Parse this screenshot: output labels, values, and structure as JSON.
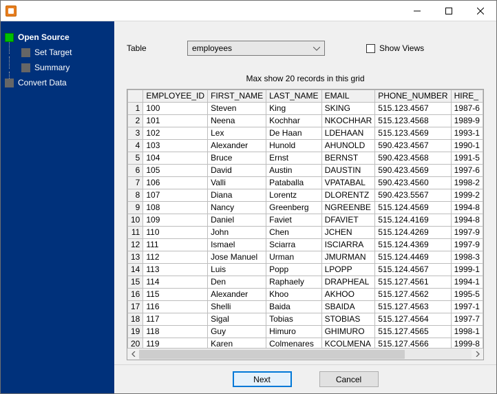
{
  "window": {
    "title": ""
  },
  "sidebar": {
    "steps": [
      {
        "label": "Open Source",
        "active": true,
        "sub": false
      },
      {
        "label": "Set Target",
        "active": false,
        "sub": true
      },
      {
        "label": "Summary",
        "active": false,
        "sub": true
      },
      {
        "label": "Convert Data",
        "active": false,
        "sub": false
      }
    ]
  },
  "controls": {
    "table_label": "Table",
    "table_value": "employees",
    "show_views_label": "Show Views",
    "show_views_checked": false
  },
  "grid": {
    "max_label": "Max show 20 records in this grid",
    "columns": [
      "EMPLOYEE_ID",
      "FIRST_NAME",
      "LAST_NAME",
      "EMAIL",
      "PHONE_NUMBER",
      "HIRE_"
    ],
    "rows": [
      {
        "n": 1,
        "c": [
          "100",
          "Steven",
          "King",
          "SKING",
          "515.123.4567",
          "1987-6"
        ]
      },
      {
        "n": 2,
        "c": [
          "101",
          "Neena",
          "Kochhar",
          "NKOCHHAR",
          "515.123.4568",
          "1989-9"
        ]
      },
      {
        "n": 3,
        "c": [
          "102",
          "Lex",
          "De Haan",
          "LDEHAAN",
          "515.123.4569",
          "1993-1"
        ]
      },
      {
        "n": 4,
        "c": [
          "103",
          "Alexander",
          "Hunold",
          "AHUNOLD",
          "590.423.4567",
          "1990-1"
        ]
      },
      {
        "n": 5,
        "c": [
          "104",
          "Bruce",
          "Ernst",
          "BERNST",
          "590.423.4568",
          "1991-5"
        ]
      },
      {
        "n": 6,
        "c": [
          "105",
          "David",
          "Austin",
          "DAUSTIN",
          "590.423.4569",
          "1997-6"
        ]
      },
      {
        "n": 7,
        "c": [
          "106",
          "Valli",
          "Pataballa",
          "VPATABAL",
          "590.423.4560",
          "1998-2"
        ]
      },
      {
        "n": 8,
        "c": [
          "107",
          "Diana",
          "Lorentz",
          "DLORENTZ",
          "590.423.5567",
          "1999-2"
        ]
      },
      {
        "n": 9,
        "c": [
          "108",
          "Nancy",
          "Greenberg",
          "NGREENBE",
          "515.124.4569",
          "1994-8"
        ]
      },
      {
        "n": 10,
        "c": [
          "109",
          "Daniel",
          "Faviet",
          "DFAVIET",
          "515.124.4169",
          "1994-8"
        ]
      },
      {
        "n": 11,
        "c": [
          "110",
          "John",
          "Chen",
          "JCHEN",
          "515.124.4269",
          "1997-9"
        ]
      },
      {
        "n": 12,
        "c": [
          "111",
          "Ismael",
          "Sciarra",
          "ISCIARRA",
          "515.124.4369",
          "1997-9"
        ]
      },
      {
        "n": 13,
        "c": [
          "112",
          "Jose Manuel",
          "Urman",
          "JMURMAN",
          "515.124.4469",
          "1998-3"
        ]
      },
      {
        "n": 14,
        "c": [
          "113",
          "Luis",
          "Popp",
          "LPOPP",
          "515.124.4567",
          "1999-1"
        ]
      },
      {
        "n": 15,
        "c": [
          "114",
          "Den",
          "Raphaely",
          "DRAPHEAL",
          "515.127.4561",
          "1994-1"
        ]
      },
      {
        "n": 16,
        "c": [
          "115",
          "Alexander",
          "Khoo",
          "AKHOO",
          "515.127.4562",
          "1995-5"
        ]
      },
      {
        "n": 17,
        "c": [
          "116",
          "Shelli",
          "Baida",
          "SBAIDA",
          "515.127.4563",
          "1997-1"
        ]
      },
      {
        "n": 18,
        "c": [
          "117",
          "Sigal",
          "Tobias",
          "STOBIAS",
          "515.127.4564",
          "1997-7"
        ]
      },
      {
        "n": 19,
        "c": [
          "118",
          "Guy",
          "Himuro",
          "GHIMURO",
          "515.127.4565",
          "1998-1"
        ]
      },
      {
        "n": 20,
        "c": [
          "119",
          "Karen",
          "Colmenares",
          "KCOLMENA",
          "515.127.4566",
          "1999-8"
        ]
      }
    ]
  },
  "footer": {
    "next_label": "Next",
    "cancel_label": "Cancel"
  }
}
